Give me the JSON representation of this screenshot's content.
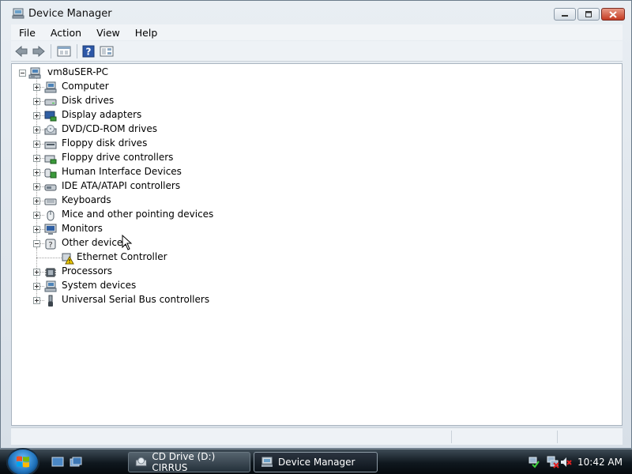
{
  "window": {
    "title": "Device Manager"
  },
  "menu": [
    "File",
    "Action",
    "View",
    "Help"
  ],
  "toolbar": {
    "buttons": [
      "back-icon",
      "forward-icon",
      "properties-icon",
      "help-icon",
      "scan-hardware-icon"
    ]
  },
  "tree": {
    "root": "vm8uSER-PC",
    "categories": [
      {
        "label": "Computer",
        "icon": "computer-icon",
        "expanded": false
      },
      {
        "label": "Disk drives",
        "icon": "disk-drive-icon",
        "expanded": false
      },
      {
        "label": "Display adapters",
        "icon": "display-adapter-icon",
        "expanded": false
      },
      {
        "label": "DVD/CD-ROM drives",
        "icon": "dvd-drive-icon",
        "expanded": false
      },
      {
        "label": "Floppy disk drives",
        "icon": "floppy-drive-icon",
        "expanded": false
      },
      {
        "label": "Floppy drive controllers",
        "icon": "floppy-controller-icon",
        "expanded": false
      },
      {
        "label": "Human Interface Devices",
        "icon": "hid-icon",
        "expanded": false
      },
      {
        "label": "IDE ATA/ATAPI controllers",
        "icon": "ide-controller-icon",
        "expanded": false
      },
      {
        "label": "Keyboards",
        "icon": "keyboard-icon",
        "expanded": false
      },
      {
        "label": "Mice and other pointing devices",
        "icon": "mouse-icon",
        "expanded": false
      },
      {
        "label": "Monitors",
        "icon": "monitor-icon",
        "expanded": false
      },
      {
        "label": "Other devices",
        "icon": "unknown-device-icon",
        "expanded": true,
        "children": [
          {
            "label": "Ethernet Controller",
            "icon": "warning-device-icon"
          }
        ]
      },
      {
        "label": "Processors",
        "icon": "processor-icon",
        "expanded": false
      },
      {
        "label": "System devices",
        "icon": "system-device-icon",
        "expanded": false
      },
      {
        "label": "Universal Serial Bus controllers",
        "icon": "usb-icon",
        "expanded": false
      }
    ]
  },
  "taskbar": {
    "items": [
      {
        "label": "CD Drive (D:) CIRRUS",
        "icon": "cd-drive-icon",
        "active": false
      },
      {
        "label": "Device Manager",
        "icon": "device-manager-icon",
        "active": true
      }
    ],
    "clock": "10:42 AM"
  }
}
